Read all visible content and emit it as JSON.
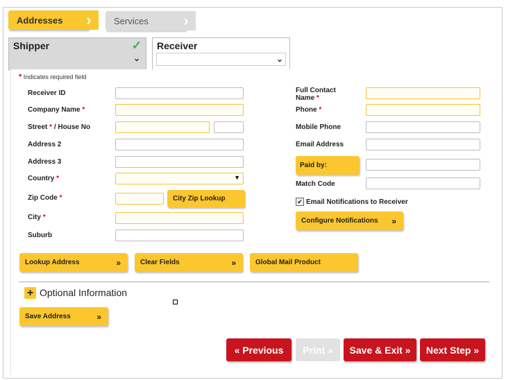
{
  "steps": {
    "addresses": "Addresses",
    "services": "Services"
  },
  "parties": {
    "shipper": "Shipper",
    "receiver": "Receiver"
  },
  "required_note": "Indicates required field",
  "required_mark": "*",
  "left_fields": {
    "receiver_id": "Receiver ID",
    "company_name": "Company Name",
    "street": "Street",
    "house_no": "/ House No",
    "address2": "Address 2",
    "address3": "Address 3",
    "country": "Country",
    "zip_code": "Zip Code",
    "city": "City",
    "suburb": "Suburb"
  },
  "right_fields": {
    "contact_line1": "Full Contact",
    "contact_line2": "Name",
    "phone": "Phone",
    "mobile": "Mobile Phone",
    "email": "Email Address",
    "paid_by": "Paid by:",
    "match_code": "Match Code",
    "email_notifications": "Email Notifications to Receiver",
    "configure_notifications": "Configure Notifications"
  },
  "buttons": {
    "city_zip_lookup": "City Zip Lookup",
    "lookup_address": "Lookup Address",
    "clear_fields": "Clear Fields",
    "global_mail_product": "Global Mail Product",
    "save_address": "Save Address",
    "double_arrow": "»",
    "previous": "« Previous",
    "print": "Print »",
    "save_exit": "Save & Exit »",
    "next_step": "Next Step »"
  },
  "optional_info": "Optional Information",
  "colors": {
    "accent": "#fcc72e",
    "danger": "#c8141e",
    "required": "#d40511"
  },
  "email_notifications_checked": true
}
